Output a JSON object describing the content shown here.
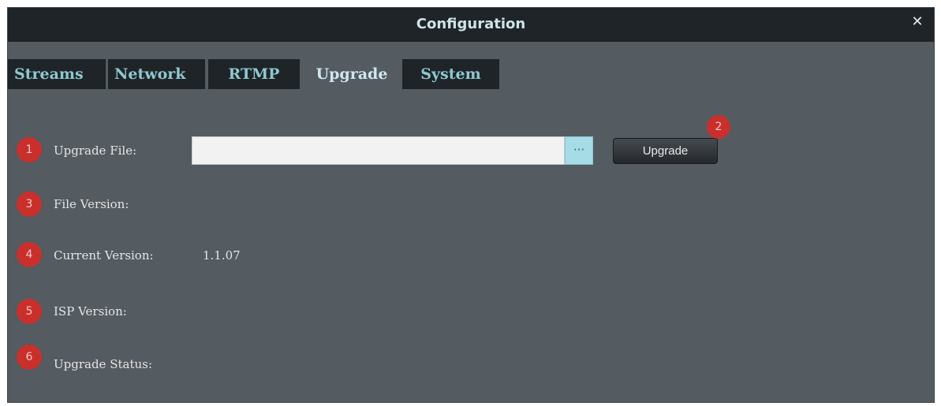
{
  "window": {
    "title": "Configuration"
  },
  "tabs": [
    {
      "label": "Streams"
    },
    {
      "label": "Network"
    },
    {
      "label": "RTMP"
    },
    {
      "label": "Upgrade",
      "active": true
    },
    {
      "label": "System"
    }
  ],
  "form": {
    "upgrade_file_label": "Upgrade File:",
    "upgrade_file_value": "",
    "browse_label": "···",
    "upgrade_button_label": "Upgrade",
    "file_version_label": "File Version:",
    "file_version_value": "",
    "current_version_label": "Current Version:",
    "current_version_value": "1.1.07",
    "isp_version_label": "ISP Version:",
    "isp_version_value": "",
    "upgrade_status_label": "Upgrade Status:",
    "upgrade_status_value": ""
  },
  "markers": {
    "upgrade_file": "1",
    "upgrade_button": "2",
    "file_version": "3",
    "current_version": "4",
    "isp_version": "5",
    "upgrade_status": "6"
  },
  "colors": {
    "background": "#545b61",
    "titlebar": "#1f2428",
    "tab_text": "#8ec8cf",
    "marker": "#c9302c",
    "browse_button": "#a6dce6"
  },
  "icons": {
    "close": "close-icon"
  }
}
